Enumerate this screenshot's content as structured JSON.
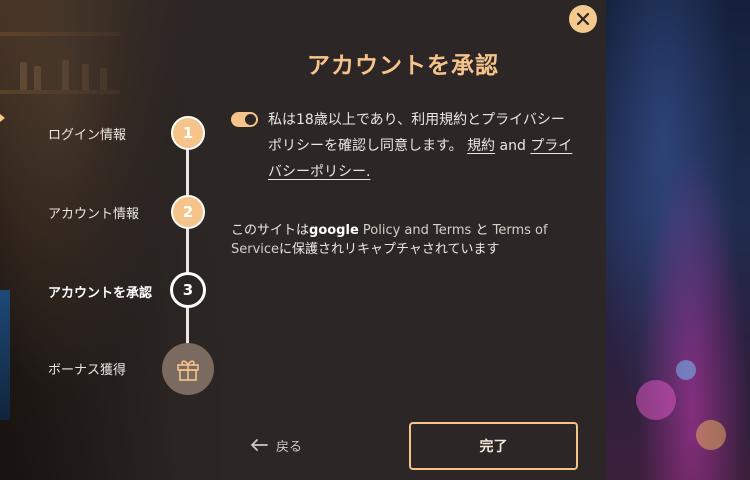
{
  "modal": {
    "title": "アカウントを承認",
    "close_icon": "close-icon",
    "accent_color": "#f5c48a"
  },
  "stepper": {
    "steps": [
      {
        "label": "ログイン情報",
        "number": "1",
        "state": "done"
      },
      {
        "label": "アカウント情報",
        "number": "2",
        "state": "done"
      },
      {
        "label": "アカウントを承認",
        "number": "3",
        "state": "current"
      },
      {
        "label": "ボーナス獲得",
        "icon": "gift-icon",
        "state": "upcoming"
      }
    ]
  },
  "consent": {
    "toggle_on": true,
    "text": "私は18歳以上であり、利用規約とプライバシーポリシーを確認し同意します。",
    "link_terms": "規約",
    "and": "and",
    "link_privacy": "プライバシーポリシー."
  },
  "recaptcha": {
    "prefix": "このサイトは",
    "google": "google",
    "policy_terms": "Policy and Terms",
    "and": "と",
    "terms_of_service": "Terms of Service",
    "suffix": "に保護されリキャプチャされています"
  },
  "footer": {
    "back_label": "戻る",
    "finish_label": "完了"
  }
}
